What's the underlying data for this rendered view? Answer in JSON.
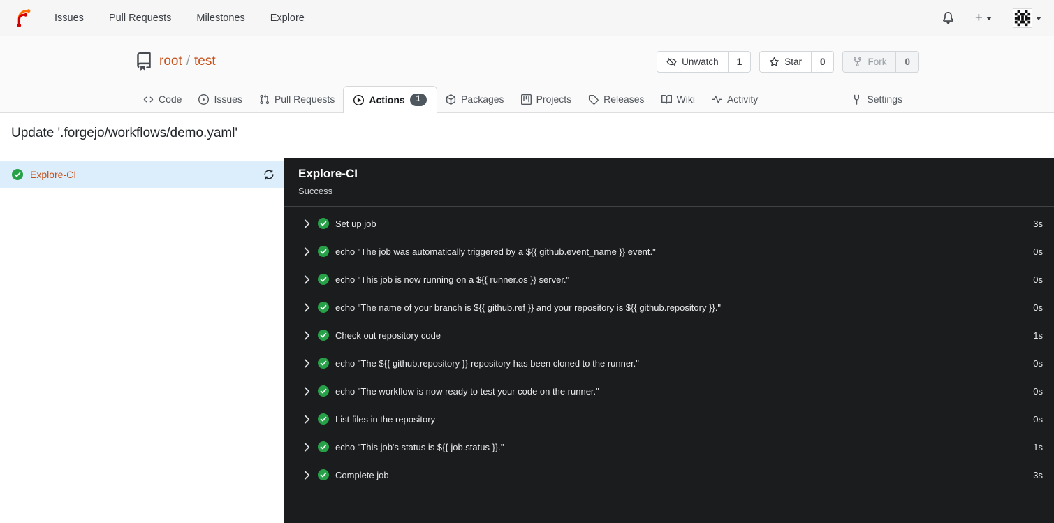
{
  "navbar": {
    "links": [
      {
        "label": "Issues"
      },
      {
        "label": "Pull Requests"
      },
      {
        "label": "Milestones"
      },
      {
        "label": "Explore"
      }
    ],
    "create_label": "+"
  },
  "repo": {
    "owner": "root",
    "separator": "/",
    "name": "test",
    "buttons": [
      {
        "label": "Unwatch",
        "count": "1",
        "icon": "eye-slash"
      },
      {
        "label": "Star",
        "count": "0",
        "icon": "star"
      },
      {
        "label": "Fork",
        "count": "0",
        "icon": "fork",
        "disabled": true
      }
    ]
  },
  "tabs": [
    {
      "label": "Code"
    },
    {
      "label": "Issues"
    },
    {
      "label": "Pull Requests"
    },
    {
      "label": "Actions",
      "badge": "1",
      "active": true
    },
    {
      "label": "Packages"
    },
    {
      "label": "Projects"
    },
    {
      "label": "Releases"
    },
    {
      "label": "Wiki"
    },
    {
      "label": "Activity"
    },
    {
      "label": "Settings"
    }
  ],
  "run": {
    "commit_title": "Update '.forgejo/workflows/demo.yaml'",
    "job": {
      "name": "Explore-CI",
      "status": "success"
    },
    "panel": {
      "title": "Explore-CI",
      "status": "Success"
    },
    "steps": [
      {
        "name": "Set up job",
        "duration": "3s"
      },
      {
        "name": "echo \"The job was automatically triggered by a ${{ github.event_name }} event.\"",
        "duration": "0s"
      },
      {
        "name": "echo \"This job is now running on a ${{ runner.os }} server.\"",
        "duration": "0s"
      },
      {
        "name": "echo \"The name of your branch is ${{ github.ref }} and your repository is ${{ github.repository }}.\"",
        "duration": "0s"
      },
      {
        "name": "Check out repository code",
        "duration": "1s"
      },
      {
        "name": "echo \"The ${{ github.repository }} repository has been cloned to the runner.\"",
        "duration": "0s"
      },
      {
        "name": "echo \"The workflow is now ready to test your code on the runner.\"",
        "duration": "0s"
      },
      {
        "name": "List files in the repository",
        "duration": "0s"
      },
      {
        "name": "echo \"This job's status is ${{ job.status }}.\"",
        "duration": "1s"
      },
      {
        "name": "Complete job",
        "duration": "3s"
      }
    ]
  },
  "colors": {
    "accent_orange": "#c6501a",
    "success_green": "#26a148",
    "panel_bg": "#1a1c1e",
    "selected_job_bg": "#dceefb",
    "badge_bg": "#4e565e"
  }
}
